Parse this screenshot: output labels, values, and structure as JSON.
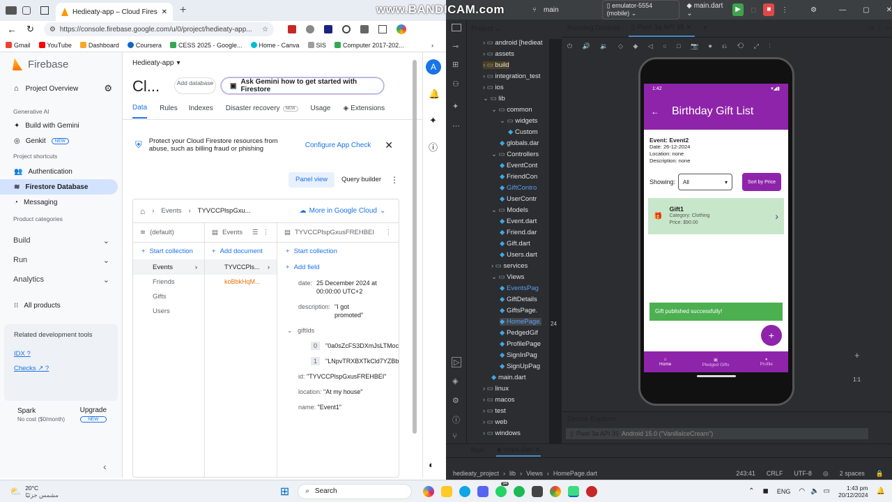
{
  "browser": {
    "tab_title": "Hedieaty-app – Cloud Firestore -",
    "url": "https://console.firebase.google.com/u/0/project/hedieaty-app...",
    "bookmarks": [
      "Gmail",
      "YouTube",
      "Dashboard",
      "Coursera",
      "CESS 2025 - Google...",
      "Home - Canva",
      "SIS",
      "Computer 2017-202..."
    ]
  },
  "firebase": {
    "brand": "Firebase",
    "project_overview": "Project Overview",
    "section_genai": "Generative AI",
    "build_with_gemini": "Build with Gemini",
    "genkit": "Genkit",
    "new_badge": "NEW",
    "section_shortcuts": "Project shortcuts",
    "authentication": "Authentication",
    "firestore": "Firestore Database",
    "messaging": "Messaging",
    "section_categories": "Product categories",
    "build": "Build",
    "run": "Run",
    "analytics": "Analytics",
    "all_products": "All products",
    "related_tools": "Related development tools",
    "idx": "IDX",
    "checks": "Checks",
    "plan": "Spark",
    "plan_cost": "No cost ($0/month)",
    "upgrade": "Upgrade",
    "project_name": "Hedieaty-app",
    "page_title": "Cl...",
    "add_database": "Add database",
    "gemini_prompt": "Ask Gemini how to get started with Firestore",
    "tabs": [
      "Data",
      "Rules",
      "Indexes",
      "Disaster recovery",
      "Usage",
      "Extensions"
    ],
    "notice": "Protect your Cloud Firestore resources from abuse, such as billing fraud or phishing",
    "configure_app_check": "Configure App Check",
    "panel_view": "Panel view",
    "query_builder": "Query builder",
    "breadcrumb": [
      "Events",
      "TYVCCPlspGxu..."
    ],
    "more_cloud": "More in Google Cloud",
    "col1_head": "(default)",
    "col2_head": "Events",
    "col3_head": "TYVCCPlspGxusFREHBEI",
    "start_collection": "Start collection",
    "add_document": "Add document",
    "add_field": "Add field",
    "collections": [
      "Events",
      "Friends",
      "Gifts",
      "Users"
    ],
    "documents": [
      "TYVCCPls...",
      "koBbkHqM..."
    ],
    "fields": {
      "date_key": "date:",
      "date_val": "25 December 2024 at 00:00:00 UTC+2",
      "desc_key": "description:",
      "desc_val": "\"I got promoted\"",
      "gift_key": "giftIds",
      "gift0_idx": "0",
      "gift0": "\"0a0sZcFS3DXmJsLTMoc",
      "gift1_idx": "1",
      "gift1": "\"LNpvTRXBXTkCld7YZBbe",
      "id_key": "id:",
      "id_val": "\"TYVCCPlspGxusFREHBEI\"",
      "loc_key": "location:",
      "loc_val": "\"At my house\"",
      "name_key": "name:",
      "name_val": "\"Event1\""
    }
  },
  "ide": {
    "recording_watermark": "www.BANDICAM.com",
    "branch": "main",
    "device_select": "emulator-5554 (mobile)",
    "run_config": "main.dart",
    "project_label": "Project",
    "running_devices": "Running Devices",
    "device_tab": "Pixel 3a API 35",
    "tree": [
      "android [hedieat",
      "assets",
      "build",
      "integration_test",
      "ios",
      "lib",
      "common",
      "widgets",
      "Custom",
      "globals.dar",
      "Controllers",
      "EventCont",
      "FriendCon",
      "GiftContro",
      "UserContr",
      "Models",
      "Event.dart",
      "Friend.dar",
      "Gift.dart",
      "Users.dart",
      "services",
      "Views",
      "EventsPag",
      "GiftDetails",
      "GiftsPage.",
      "HomePage.",
      "PedgedGif",
      "ProfilePage",
      "SignInPag",
      "SignUpPag",
      "main.dart",
      "linux",
      "macos",
      "test",
      "web",
      "windows"
    ],
    "device_explorer": "Device Explorer",
    "device_explorer_item": "Pixel 3a API 35",
    "device_explorer_sub": "Android 15.0 (\"VanillaIceCream\")",
    "run_tab": "Run",
    "run_file": "main.dart",
    "status_path": [
      "hedieaty_project",
      "lib",
      "Views",
      "HomePage.dart"
    ],
    "cursor": "243:41",
    "line_sep": "CRLF",
    "encoding": "UTF-8",
    "indent": "2 spaces",
    "zoom_ratio": "1:1",
    "gutter_line": "24"
  },
  "phone": {
    "time": "1:42",
    "title": "Birthday Gift List",
    "event": "Event: Event2",
    "date": "Date: 26-12-2024",
    "location": "Location: none",
    "description": "Description: none",
    "showing": "Showing:",
    "filter": "All",
    "sort": "Sort by Price",
    "gift_name": "Gift1",
    "gift_category": "Category: Clothing",
    "gift_price": "Price: $90.00",
    "toast": "Gift published successfully!",
    "nav": [
      "Home",
      "Pledged Gifts",
      "Profile"
    ]
  },
  "taskbar": {
    "temp": "20°C",
    "weather": "مشمس جزئيًا",
    "search": "Search",
    "lang": "ENG",
    "time": "1:43 pm",
    "date": "20/12/2024",
    "badge": "94"
  },
  "colors": {
    "accent_blue": "#1a73e8",
    "phone_purple": "#8e24aa",
    "toast_green": "#4caf50",
    "gift_card": "#c8e6c9"
  }
}
